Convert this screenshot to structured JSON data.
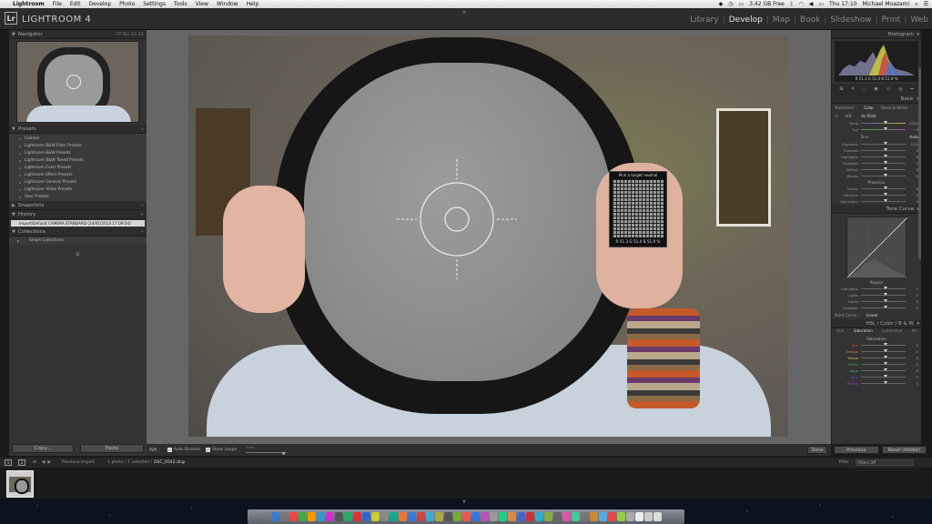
{
  "menubar": {
    "app": "Lightroom",
    "items": [
      "File",
      "Edit",
      "Develop",
      "Photo",
      "Settings",
      "Tools",
      "View",
      "Window",
      "Help"
    ],
    "storage": "3.42 GB Free",
    "clock": "Thu 17:10",
    "user": "Michael Moazami"
  },
  "identity": {
    "logo": "Lr",
    "name": "LIGHTROOM 4"
  },
  "modules": [
    "Library",
    "Develop",
    "Map",
    "Book",
    "Slideshow",
    "Print",
    "Web"
  ],
  "active_module": "Develop",
  "left": {
    "navigator": {
      "title": "Navigator",
      "zoom_opts": [
        "FIT",
        "FILL",
        "1:1",
        "2:1"
      ]
    },
    "presets": {
      "title": "Presets",
      "items": [
        "Fashion",
        "Lightroom B&W Filter Presets",
        "Lightroom B&W Presets",
        "Lightroom B&W Toned Presets",
        "Lightroom Color Presets",
        "Lightroom Effect Presets",
        "Lightroom General Presets",
        "Lightroom Video Presets",
        "User Presets"
      ]
    },
    "snapshots": {
      "title": "Snapshots"
    },
    "history": {
      "title": "History",
      "item": "Import/Default CAMERA STANDARD (24/01/2013 17:09:54)"
    },
    "collections": {
      "title": "Collections",
      "item": "Smart Collections"
    },
    "copy": "Copy...",
    "paste": "Paste"
  },
  "loupe": {
    "title": "Pick a target neutral",
    "values": "R 51.3  G 51.0  B 51.9 %"
  },
  "toolbar": {
    "wb": "WB :",
    "auto_dismiss": "Auto Dismiss",
    "show_loupe": "Show Loupe",
    "scale": "Scale",
    "done": "Done"
  },
  "right": {
    "histogram": {
      "title": "Histogram",
      "values": "R 51.3  G 51.0  B 51.9 %"
    },
    "basic": {
      "title": "Basic",
      "treatment": "Treatment :",
      "color": "Color",
      "bw": "Black & White",
      "wb": "WB :",
      "wb_value": "As Shot",
      "temp": {
        "label": "Temp",
        "value": "5200"
      },
      "tint": {
        "label": "Tint",
        "value": "+ 6"
      },
      "tone_label": "Tone",
      "auto": "Auto",
      "tone_rows": [
        {
          "label": "Exposure",
          "value": "0.00"
        },
        {
          "label": "Contrast",
          "value": "0"
        },
        {
          "label": "Highlights",
          "value": "0"
        },
        {
          "label": "Shadows",
          "value": "0"
        },
        {
          "label": "Whites",
          "value": "0"
        },
        {
          "label": "Blacks",
          "value": "0"
        }
      ],
      "presence_label": "Presence",
      "presence_rows": [
        {
          "label": "Clarity",
          "value": "0"
        },
        {
          "label": "Vibrance",
          "value": "0"
        },
        {
          "label": "Saturation",
          "value": "0"
        }
      ]
    },
    "tone_curve": {
      "title": "Tone Curve",
      "region": "Region",
      "rows": [
        {
          "label": "Highlights",
          "value": "0"
        },
        {
          "label": "Lights",
          "value": "0"
        },
        {
          "label": "Darks",
          "value": "0"
        },
        {
          "label": "Shadows",
          "value": "0"
        }
      ],
      "point_curve": "Point Curve :",
      "point_curve_value": "Linear"
    },
    "hsl": {
      "title": "HSL / Color / B & W",
      "tabs": [
        "Hue",
        "Saturation",
        "Luminance",
        "All"
      ],
      "active_tab": "Saturation",
      "sub": "Saturation",
      "rows": [
        {
          "label": "Red",
          "value": "0",
          "color": "#c44"
        },
        {
          "label": "Orange",
          "value": "0",
          "color": "#d84"
        },
        {
          "label": "Yellow",
          "value": "0",
          "color": "#cc4"
        },
        {
          "label": "Green",
          "value": "0",
          "color": "#4a4"
        },
        {
          "label": "Aqua",
          "value": "0",
          "color": "#4aa"
        },
        {
          "label": "Blue",
          "value": "0",
          "color": "#44c"
        },
        {
          "label": "Purple",
          "value": "0",
          "color": "#a4c"
        }
      ]
    },
    "previous": "Previous",
    "reset": "Reset (Adobe)"
  },
  "filmbar": {
    "pages": [
      "1",
      "2"
    ],
    "source": "Previous Import",
    "count": "1 photo / 1 selected /",
    "file": "DSC_0542.dng",
    "filter_label": "Filter :",
    "filter_value": "Filters Off"
  }
}
